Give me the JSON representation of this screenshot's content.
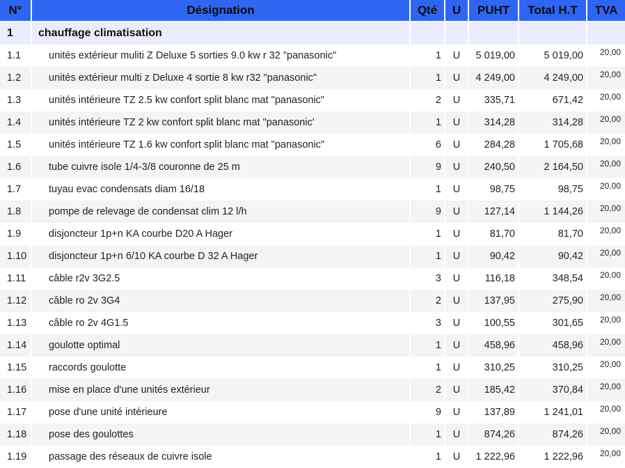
{
  "headers": {
    "num": "N°",
    "designation": "Désignation",
    "qte": "Qté",
    "u": "U",
    "puht": "PUHT",
    "total": "Total H.T",
    "tva": "TVA"
  },
  "section": {
    "num": "1",
    "title": "chauffage climatisation"
  },
  "items": [
    {
      "num": "1.1",
      "des": "unités extérieur muliti Z Deluxe 5 sorties 9.0 kw r 32  \"panasonic\"",
      "qte": "1",
      "u": "U",
      "puht": "5 019,00",
      "total": "5 019,00",
      "tva": "20,00"
    },
    {
      "num": "1.2",
      "des": "unités extérieur multi z Deluxe 4 sortie 8 kw r32 \"panasonic\"",
      "qte": "1",
      "u": "U",
      "puht": "4 249,00",
      "total": "4 249,00",
      "tva": "20,00"
    },
    {
      "num": "1.3",
      "des": "unités intérieure TZ 2.5 kw confort split blanc mat \"panasonic\"",
      "qte": "2",
      "u": "U",
      "puht": "335,71",
      "total": "671,42",
      "tva": "20,00"
    },
    {
      "num": "1.4",
      "des": "unités intérieure TZ  2 kw confort split blanc mat \"panasonic'",
      "qte": "1",
      "u": "U",
      "puht": "314,28",
      "total": "314,28",
      "tva": "20,00"
    },
    {
      "num": "1.5",
      "des": "unités intérieure TZ 1.6 kw confort split blanc mat \"panasonic\"",
      "qte": "6",
      "u": "U",
      "puht": "284,28",
      "total": "1 705,68",
      "tva": "20,00"
    },
    {
      "num": "1.6",
      "des": "tube cuivre isole 1/4-3/8 couronne de 25 m",
      "qte": "9",
      "u": "U",
      "puht": "240,50",
      "total": "2 164,50",
      "tva": "20,00"
    },
    {
      "num": "1.7",
      "des": "tuyau evac condensats diam 16/18",
      "qte": "1",
      "u": "U",
      "puht": "98,75",
      "total": "98,75",
      "tva": "20,00"
    },
    {
      "num": "1.8",
      "des": "pompe de relevage de condensat clim 12 l/h",
      "qte": "9",
      "u": "U",
      "puht": "127,14",
      "total": "1 144,26",
      "tva": "20,00"
    },
    {
      "num": "1.9",
      "des": "disjoncteur 1p+n KA courbe D20 A Hager",
      "qte": "1",
      "u": "U",
      "puht": "81,70",
      "total": "81,70",
      "tva": "20,00"
    },
    {
      "num": "1.10",
      "des": "disjoncteur 1p+n 6/10 KA courbe D 32 A  Hager",
      "qte": "1",
      "u": "U",
      "puht": "90,42",
      "total": "90,42",
      "tva": "20,00"
    },
    {
      "num": "1.11",
      "des": "câble r2v 3G2.5",
      "qte": "3",
      "u": "U",
      "puht": "116,18",
      "total": "348,54",
      "tva": "20,00"
    },
    {
      "num": "1.12",
      "des": "câble ro 2v 3G4",
      "qte": "2",
      "u": "U",
      "puht": "137,95",
      "total": "275,90",
      "tva": "20,00"
    },
    {
      "num": "1.13",
      "des": "câble ro 2v 4G1.5",
      "qte": "3",
      "u": "U",
      "puht": "100,55",
      "total": "301,65",
      "tva": "20,00"
    },
    {
      "num": "1.14",
      "des": "goulotte optimal",
      "qte": "1",
      "u": "U",
      "puht": "458,96",
      "total": "458,96",
      "tva": "20,00"
    },
    {
      "num": "1.15",
      "des": "raccords goulotte",
      "qte": "1",
      "u": "U",
      "puht": "310,25",
      "total": "310,25",
      "tva": "20,00"
    },
    {
      "num": "1.16",
      "des": "mise en place d'une  unités extérieur",
      "qte": "2",
      "u": "U",
      "puht": "185,42",
      "total": "370,84",
      "tva": "20,00"
    },
    {
      "num": "1.17",
      "des": "pose d'une unité intérieure",
      "qte": "9",
      "u": "U",
      "puht": "137,89",
      "total": "1 241,01",
      "tva": "20,00"
    },
    {
      "num": "1.18",
      "des": "pose des goulottes",
      "qte": "1",
      "u": "U",
      "puht": "874,26",
      "total": "874,26",
      "tva": "20,00"
    },
    {
      "num": "1.19",
      "des": "passage des réseaux de cuivre isole",
      "qte": "1",
      "u": "U",
      "puht": "1 222,96",
      "total": "1 222,96",
      "tva": "20,00"
    }
  ]
}
